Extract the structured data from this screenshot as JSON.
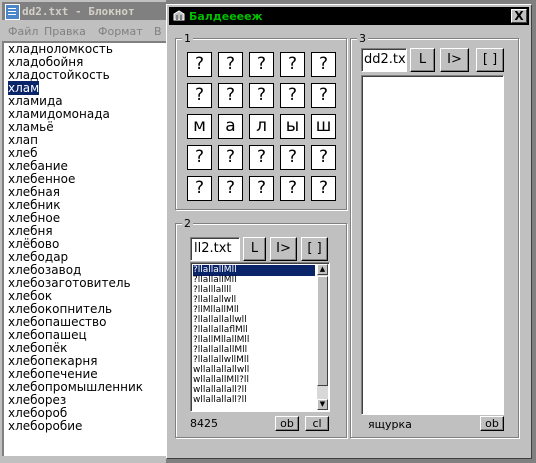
{
  "notepad": {
    "title": "dd2.txt - Блокнот",
    "menu": [
      "Файл",
      "Правка",
      "Формат",
      "В"
    ],
    "lines": [
      "хладноломкость",
      "хладобойня",
      "хладостойкость",
      "хлам",
      "хламида",
      "хламидомонада",
      "хламьё",
      "хлап",
      "хлеб",
      "хлебание",
      "хлебенное",
      "хлебная",
      "хлебник",
      "хлебное",
      "хлебня",
      "хлёбово",
      "хлебодар",
      "хлебозавод",
      "хлебозаготовитель",
      "хлебок",
      "хлебокопнитель",
      "хлебопашество",
      "хлебопашец",
      "хлебопёк",
      "хлебопекарня",
      "хлебопечение",
      "хлебопромышленник",
      "хлеборез",
      "хлебороб",
      "хлеборобие"
    ],
    "selected_line": "хлам"
  },
  "dialog": {
    "title": "Балдееееж",
    "close_glyph": "X",
    "group1": {
      "caption": "1",
      "grid": [
        [
          "?",
          "?",
          "?",
          "?",
          "?"
        ],
        [
          "?",
          "?",
          "?",
          "?",
          "?"
        ],
        [
          "м",
          "а",
          "л",
          "ы",
          "ш"
        ],
        [
          "?",
          "?",
          "?",
          "?",
          "?"
        ],
        [
          "?",
          "?",
          "?",
          "?",
          "?"
        ]
      ]
    },
    "group2": {
      "caption": "2",
      "file": "ll2.txt",
      "btn_l": "L",
      "btn_next": "I>",
      "btn_brackets": "[ ]",
      "list": [
        "?llallallMll",
        "?llallallMll",
        "?llalllallll",
        "?llallallwll",
        "?llMllallMll",
        "?llallallallwll",
        "?llallallaflMll",
        "?llallMllallMll",
        "?llallallallMll",
        "?llallallwllMll",
        "wllallallallwll",
        "wllallallMll?ll",
        "wllallallall?ll",
        "wllallallall?ll"
      ],
      "selected_index": 0,
      "count": "8425",
      "btn_ob": "ob",
      "btn_cl": "cl",
      "scroll_up": "▲",
      "scroll_down": "▼"
    },
    "group3": {
      "caption": "3",
      "file": "dd2.txt",
      "btn_l": "L",
      "btn_next": "I>",
      "btn_brackets": "[ ]",
      "word": "ящурка",
      "btn_ob": "ob"
    }
  }
}
